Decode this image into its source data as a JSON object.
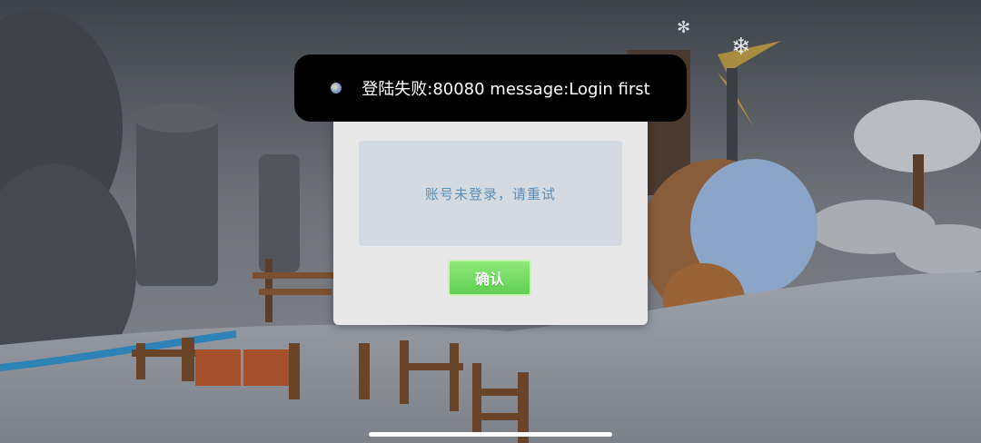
{
  "toast": {
    "icon": "game-app-icon",
    "text": "登陆失败:80080 message:Login first"
  },
  "dialog": {
    "message": "账号未登录，请重试",
    "confirm_label": "确认"
  },
  "colors": {
    "toast_bg": "#000000",
    "dialog_bg": "#e8e8e8",
    "message_bg": "#d3dae2",
    "message_text": "#5a8fb8",
    "confirm_button": "#6fd85e"
  }
}
